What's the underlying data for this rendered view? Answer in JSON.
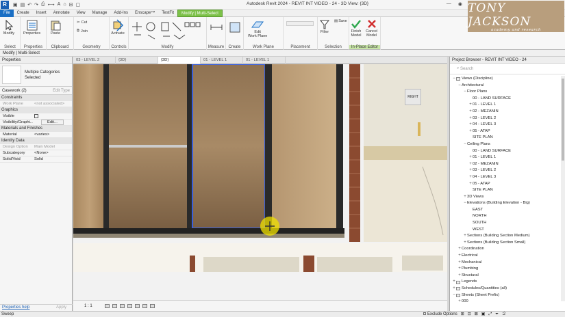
{
  "app": {
    "title": "Autodesk Revit 2024 - REVIT INT VIDEO - 24 - 3D View: {3D}",
    "brand_line1": "TONY JACKSON",
    "brand_line2": "academy and research"
  },
  "ribbon_tabs": [
    "File",
    "Create",
    "Insert",
    "Annotate",
    "View",
    "Manage",
    "Add-Ins",
    "Enscape™",
    "TestFit",
    "Modify | Multi-Select"
  ],
  "ribbon": {
    "tools": {
      "modify": "Modify",
      "properties": "Properties",
      "paste": "Paste",
      "cut": "Cut",
      "join": "Join",
      "activate": "Activate",
      "edit_work_plane": "Edit\nWork Plane",
      "filter": "Filter",
      "save": "Save",
      "finish_model": "Finish\nModel",
      "cancel_model": "Cancel\nModel"
    },
    "groups": [
      "Select",
      "Properties",
      "Clipboard",
      "Geometry",
      "Controls",
      "Modify",
      "Measure",
      "Create",
      "Work Plane",
      "Placement",
      "Selection",
      "In-Place Editor"
    ]
  },
  "mode_bar": "Modify | Multi-Select",
  "properties": {
    "header": "Properties",
    "type_name": "Multiple Categories\nSelected",
    "filter_value": "Casework (2)",
    "edit_type": "Edit Type",
    "groups": {
      "constraints": "Constraints",
      "graphics": "Graphics",
      "materials": "Materials and Finishes",
      "identity": "Identity Data"
    },
    "rows": {
      "work_plane": {
        "k": "Work Plane",
        "v": "<not associated>"
      },
      "visible": {
        "k": "Visible"
      },
      "visibility": {
        "k": "Visibility/Graphi...",
        "v": "Edit..."
      },
      "material": {
        "k": "Material",
        "v": "<varies>"
      },
      "design_option": {
        "k": "Design Option",
        "v": "Main Model"
      },
      "subcategory": {
        "k": "Subcategory",
        "v": "<None>"
      },
      "solid_void": {
        "k": "Solid/Void",
        "v": "Solid"
      }
    },
    "help": "Properties help",
    "apply": "Apply"
  },
  "view_tabs": [
    "03 - LEVEL 2",
    "{3D}",
    "{3D}",
    "01 - LEVEL 1",
    "01 - LEVEL 1"
  ],
  "viewport": {
    "viewcube_label": "RIGHT",
    "scale": "1 : 1"
  },
  "browser": {
    "header": "Project Browser - REVIT INT VIDEO - 24",
    "search_placeholder": "Search",
    "tree": [
      {
        "toggle": "−",
        "label": "Views (Discipline)",
        "indent": 0,
        "folder": true
      },
      {
        "toggle": "−",
        "label": "Architectural",
        "indent": 1
      },
      {
        "toggle": "−",
        "label": "Floor Plans",
        "indent": 2
      },
      {
        "toggle": "",
        "label": "00 - LAND SURFACE",
        "indent": 3
      },
      {
        "toggle": "+",
        "label": "01 - LEVEL 1",
        "indent": 3
      },
      {
        "toggle": "+",
        "label": "02 - MEZANIN",
        "indent": 3
      },
      {
        "toggle": "+",
        "label": "03 - LEVEL 2",
        "indent": 3
      },
      {
        "toggle": "+",
        "label": "04 - LEVEL 3",
        "indent": 3
      },
      {
        "toggle": "+",
        "label": "05 - ATAP",
        "indent": 3
      },
      {
        "toggle": "",
        "label": "SITE PLAN",
        "indent": 3
      },
      {
        "toggle": "−",
        "label": "Ceiling Plans",
        "indent": 2
      },
      {
        "toggle": "",
        "label": "00 - LAND SURFACE",
        "indent": 3
      },
      {
        "toggle": "+",
        "label": "01 - LEVEL 1",
        "indent": 3
      },
      {
        "toggle": "+",
        "label": "02 - MEZANIN",
        "indent": 3
      },
      {
        "toggle": "+",
        "label": "03 - LEVEL 2",
        "indent": 3
      },
      {
        "toggle": "+",
        "label": "04 - LEVEL 3",
        "indent": 3
      },
      {
        "toggle": "+",
        "label": "05 - ATAP",
        "indent": 3
      },
      {
        "toggle": "",
        "label": "SITE PLAN",
        "indent": 3
      },
      {
        "toggle": "+",
        "label": "3D Views",
        "indent": 2
      },
      {
        "toggle": "−",
        "label": "Elevations (Building Elevation - Big)",
        "indent": 2
      },
      {
        "toggle": "",
        "label": "EAST",
        "indent": 3
      },
      {
        "toggle": "",
        "label": "NORTH",
        "indent": 3
      },
      {
        "toggle": "",
        "label": "SOUTH",
        "indent": 3
      },
      {
        "toggle": "",
        "label": "WEST",
        "indent": 3
      },
      {
        "toggle": "+",
        "label": "Sections (Building Section Medium)",
        "indent": 2
      },
      {
        "toggle": "+",
        "label": "Sections (Building Section Small)",
        "indent": 2
      },
      {
        "toggle": "+",
        "label": "Coordination",
        "indent": 1
      },
      {
        "toggle": "+",
        "label": "Electrical",
        "indent": 1
      },
      {
        "toggle": "+",
        "label": "Mechanical",
        "indent": 1
      },
      {
        "toggle": "+",
        "label": "Plumbing",
        "indent": 1
      },
      {
        "toggle": "+",
        "label": "Structural",
        "indent": 1
      },
      {
        "toggle": "+",
        "label": "Legends",
        "indent": 0,
        "folder": true
      },
      {
        "toggle": "+",
        "label": "Schedules/Quantities (all)",
        "indent": 0,
        "folder": true
      },
      {
        "toggle": "−",
        "label": "Sheets (Sheet Prefix)",
        "indent": 0,
        "folder": true
      },
      {
        "toggle": "+",
        "label": "000",
        "indent": 1
      }
    ]
  },
  "status": {
    "left": "Sweep",
    "exclude": "Exclude Options",
    "filter_count": ":2"
  },
  "colors": {
    "file_tab": "#1a6fc4",
    "context_tab": "#7cc148",
    "brand_bg": "#b89e7d",
    "highlight": "#f0e000"
  }
}
